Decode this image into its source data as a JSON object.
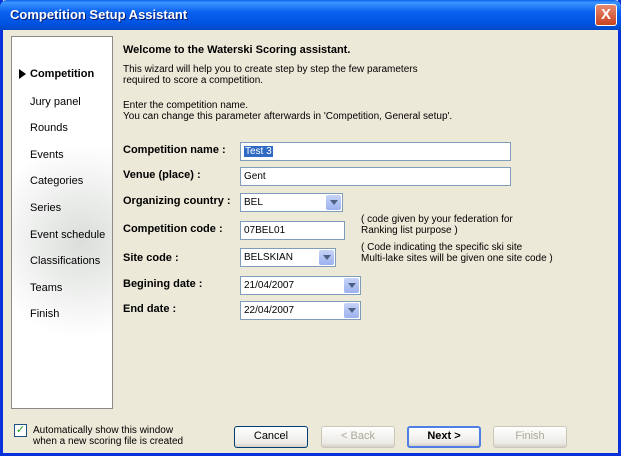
{
  "window": {
    "title": "Competition Setup Assistant",
    "close_label": "X"
  },
  "nav": {
    "items": [
      {
        "label": "Competition",
        "active": true
      },
      {
        "label": "Jury panel"
      },
      {
        "label": "Rounds"
      },
      {
        "label": "Events"
      },
      {
        "label": "Categories"
      },
      {
        "label": "Series"
      },
      {
        "label": "Event schedule"
      },
      {
        "label": "Classifications"
      },
      {
        "label": "Teams"
      },
      {
        "label": "Finish"
      }
    ]
  },
  "intro": {
    "welcome": "Welcome to the Waterski Scoring assistant.",
    "desc1": "This wizard will help you to create step by step the few parameters required to score a competition.",
    "desc2": "Enter the competition name.\nYou can change this parameter afterwards in 'Competition, General setup'."
  },
  "form": {
    "competition_name_label": "Competition name :",
    "competition_name_value": "Test 3",
    "venue_label": "Venue (place) :",
    "venue_value": "Gent",
    "country_label": "Organizing country :",
    "country_value": "BEL",
    "code_label": "Competition code :",
    "code_value": "07BEL01",
    "code_note": "( code given by your federation for\n  Ranking list purpose )",
    "site_label": "Site code :",
    "site_value": "BELSKIAN",
    "site_note": "( Code indicating the specific ski site\n  Multi-lake sites will be given one site code )",
    "begin_label": "Begining date :",
    "begin_value": "21/04/2007",
    "end_label": "End date :",
    "end_value": "22/04/2007"
  },
  "footer": {
    "auto_show_label": "Automatically show this window\n  when a new scoring file is created",
    "auto_show_checked": true,
    "cancel_label": "Cancel",
    "back_label": "< Back",
    "next_label": "Next >",
    "finish_label": "Finish"
  }
}
